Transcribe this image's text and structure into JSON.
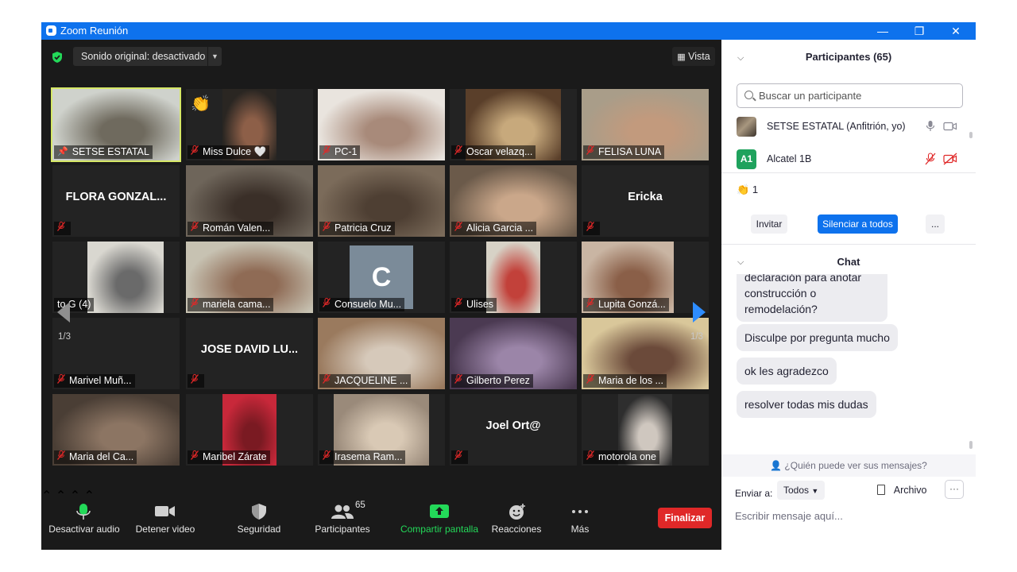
{
  "window": {
    "title": "Zoom Reunión",
    "controls": {
      "minimize": "—",
      "maximize": "❐",
      "close": "✕"
    }
  },
  "video": {
    "sound_original": "Sonido original: desactivado",
    "view_label": "Vista",
    "page_indicator": "1/3",
    "tiles": [
      {
        "name": "SETSE ESTATAL",
        "muted": false,
        "pinned": true,
        "selected": true,
        "kind": "video",
        "colors": [
          "#cfd2cc",
          "#6f6a5e"
        ]
      },
      {
        "name": "Miss Dulce 🤍",
        "muted": true,
        "raised_hand": true,
        "kind": "video",
        "colors": [
          "#2a2622",
          "#8d5f48"
        ]
      },
      {
        "name": "PC-1",
        "muted": true,
        "kind": "video",
        "colors": [
          "#e9e4de",
          "#a88a7a"
        ]
      },
      {
        "name": "Oscar velazq...",
        "muted": true,
        "kind": "video",
        "colors": [
          "#5a3f2a",
          "#c7a97c"
        ]
      },
      {
        "name": "FELISA LUNA",
        "muted": true,
        "kind": "video",
        "colors": [
          "#a99d89",
          "#c29a7d"
        ]
      },
      {
        "name": "",
        "display_name": "FLORA GONZAL...",
        "muted": true,
        "kind": "name"
      },
      {
        "name": "Román Valen...",
        "muted": true,
        "kind": "video",
        "colors": [
          "#6e655a",
          "#3a2f28"
        ]
      },
      {
        "name": "Patricia Cruz",
        "muted": true,
        "kind": "video",
        "colors": [
          "#7b6b5a",
          "#4e3f33"
        ]
      },
      {
        "name": "Alicia Garcia ...",
        "muted": true,
        "kind": "video",
        "colors": [
          "#6b5a4a",
          "#caa78a"
        ]
      },
      {
        "name": "",
        "display_name": "Ericka",
        "muted": true,
        "kind": "name"
      },
      {
        "name": "to G (4)",
        "muted": false,
        "kind": "video",
        "colors": [
          "#d9d7d0",
          "#6a6a6a"
        ]
      },
      {
        "name": "mariela cama...",
        "muted": true,
        "kind": "video",
        "colors": [
          "#c7c2b2",
          "#8f6b55"
        ]
      },
      {
        "name": "Consuelo Mu...",
        "muted": true,
        "kind": "avatar",
        "initial": "C"
      },
      {
        "name": "Ulises",
        "muted": true,
        "kind": "video",
        "colors": [
          "#d7d2c6",
          "#c2413a"
        ]
      },
      {
        "name": "Lupita Gonzá...",
        "muted": true,
        "kind": "video",
        "colors": [
          "#c9b5a3",
          "#8a5f48"
        ]
      },
      {
        "name": "Marivel Muñ...",
        "muted": true,
        "kind": "blank"
      },
      {
        "name": "",
        "display_name": "JOSE DAVID LU...",
        "muted": true,
        "kind": "name"
      },
      {
        "name": "JACQUELINE ...",
        "muted": true,
        "kind": "video",
        "colors": [
          "#9a7a5e",
          "#d6c9ba"
        ]
      },
      {
        "name": "Gilberto Perez",
        "muted": true,
        "kind": "video",
        "colors": [
          "#4b3a52",
          "#9b85a8"
        ]
      },
      {
        "name": "Maria de los ...",
        "muted": true,
        "kind": "video",
        "colors": [
          "#d9c79a",
          "#6b4a3a"
        ]
      },
      {
        "name": "Maria del Ca...",
        "muted": true,
        "kind": "video",
        "colors": [
          "#4a3e35",
          "#8c7563"
        ]
      },
      {
        "name": "Maribel Zárate",
        "muted": true,
        "kind": "video",
        "colors": [
          "#c8283a",
          "#7a1a22"
        ]
      },
      {
        "name": "Irasema Ram...",
        "muted": true,
        "kind": "video",
        "colors": [
          "#9a8a7a",
          "#d9c9b5"
        ]
      },
      {
        "name": "",
        "display_name": "Joel Ort@",
        "muted": true,
        "kind": "name"
      },
      {
        "name": "motorola one",
        "muted": true,
        "kind": "video",
        "colors": [
          "#2e2e2e",
          "#cfc7bf"
        ]
      }
    ]
  },
  "toolbar": {
    "audio": "Desactivar audio",
    "video": "Detener video",
    "security": "Seguridad",
    "participants": "Participantes",
    "participants_count": "65",
    "share": "Compartir pantalla",
    "reactions": "Reacciones",
    "more": "Más",
    "end": "Finalizar",
    "colors": {
      "share": "#23d959",
      "end": "#e02828"
    }
  },
  "panel": {
    "participants_title": "Participantes (65)",
    "search_placeholder": "Buscar un participante",
    "participants": [
      {
        "name": "SETSE ESTATAL (Anfitrión, yo)",
        "avatar": "photo"
      },
      {
        "name": "Alcatel 1B",
        "avatar": "A1",
        "avatar_color": "#1fa25d"
      }
    ],
    "raised_hands": "1",
    "invite": "Invitar",
    "mute_all": "Silenciar a todos",
    "more": "...",
    "chat_title": "Chat",
    "messages": [
      "declaración para anotar construcción o remodelación?",
      "Disculpe por pregunta mucho",
      "ok les agradezco",
      "resolver todas mis dudas"
    ],
    "who_can_see": "¿Quién puede ver sus mensajes?",
    "send_to_label": "Enviar a:",
    "send_to_value": "Todos",
    "file": "Archivo",
    "file_more": "···",
    "compose_placeholder": "Escribir mensaje aquí..."
  }
}
